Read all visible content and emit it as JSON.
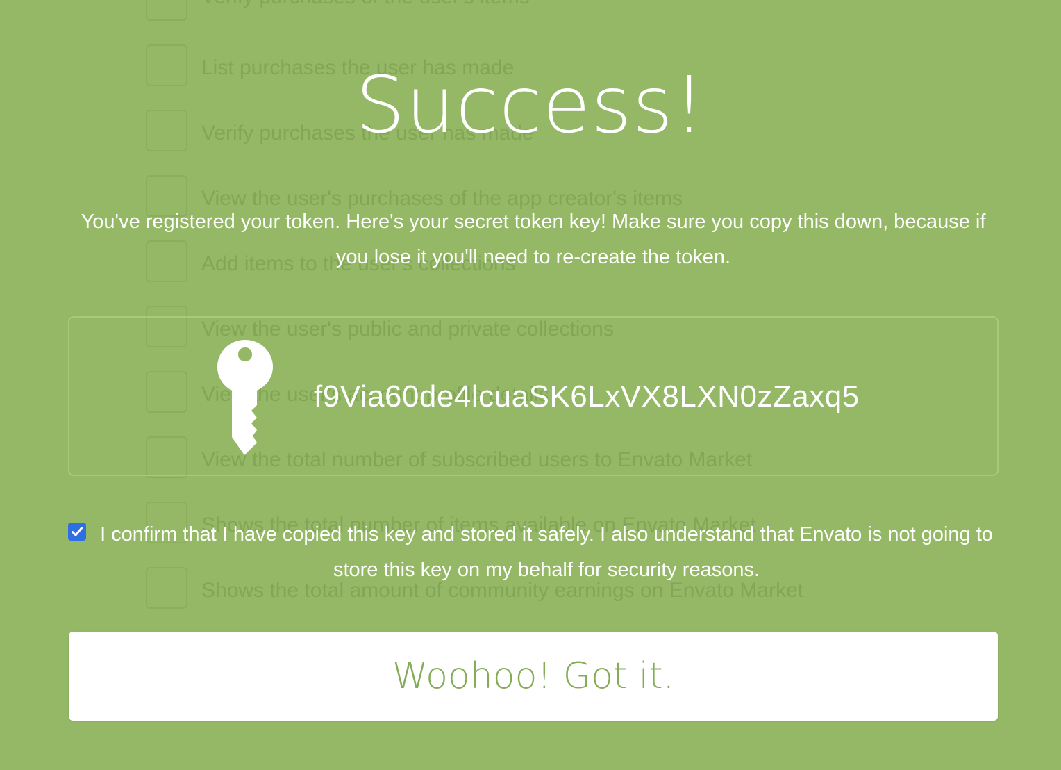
{
  "background_list": {
    "items": [
      "Verify purchases of the user's items",
      "List purchases the user has made",
      "Verify purchases the user has made",
      "View the user's purchases of the app creator's items",
      "Add items to the user's collections",
      "View the user's public and private collections",
      "View the user's account profile details",
      "View the total number of subscribed users to Envato Market",
      "Shows the total number of items available on Envato Market",
      "Shows the total amount of community earnings on Envato Market"
    ]
  },
  "dialog": {
    "title": "Success!",
    "message": "You've registered your token. Here's your secret token key! Make sure you copy this down, because if you lose it you'll need to re-create the token.",
    "token": {
      "icon": "key-icon",
      "value": "f9Via60de4lcuaSK6LxVX8LXN0zZaxq5"
    },
    "confirm": {
      "checked": true,
      "label": "I confirm that I have copied this key and stored it safely. I also understand that Envato is not going to store this key on my behalf for security reasons."
    },
    "button_label": "Woohoo! Got it."
  },
  "colors": {
    "background": "#95b866",
    "button_text": "#86ab58",
    "checkbox": "#2f6fe3"
  }
}
